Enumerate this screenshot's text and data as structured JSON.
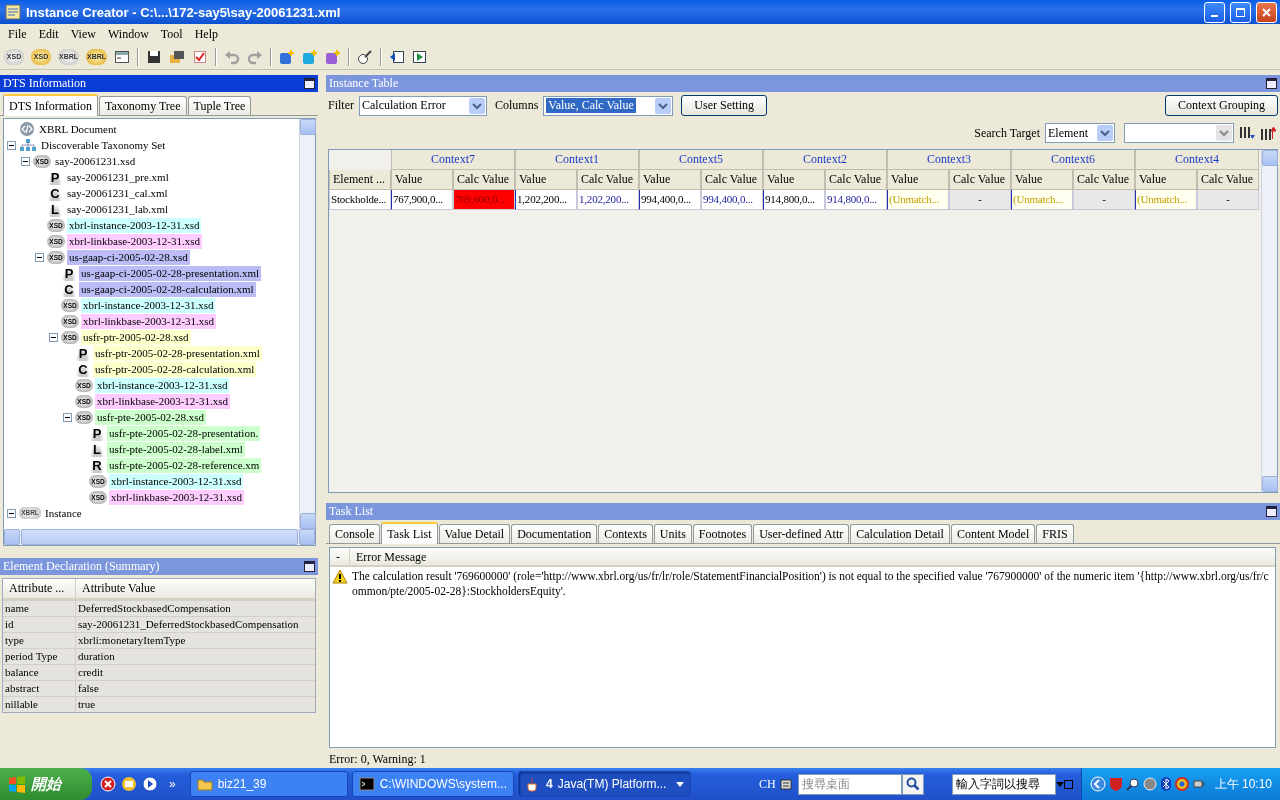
{
  "window": {
    "title": "Instance Creator - C:\\...\\172-say5\\say-20061231.xml"
  },
  "menu": [
    "File",
    "Edit",
    "View",
    "Window",
    "Tool",
    "Help"
  ],
  "toolbar": [
    {
      "kind": "xsd",
      "badge": "XSD"
    },
    {
      "kind": "xsd-open",
      "badge": "XSD"
    },
    {
      "kind": "xbrl",
      "badge": "XBRL"
    },
    {
      "kind": "xbrl-open",
      "badge": "XBRL"
    },
    {
      "kind": "window"
    },
    {
      "kind": "separator"
    },
    {
      "kind": "save"
    },
    {
      "kind": "folders"
    },
    {
      "kind": "check"
    },
    {
      "kind": "separator"
    },
    {
      "kind": "undo",
      "disabled": true
    },
    {
      "kind": "redo",
      "disabled": true
    },
    {
      "kind": "separator"
    },
    {
      "kind": "add-blue"
    },
    {
      "kind": "add-cyan"
    },
    {
      "kind": "add-purple"
    },
    {
      "kind": "separator"
    },
    {
      "kind": "tool"
    },
    {
      "kind": "separator"
    },
    {
      "kind": "prev"
    },
    {
      "kind": "next"
    }
  ],
  "dts_panel": {
    "title": "DTS Information",
    "active": true,
    "tabs": [
      {
        "label": "DTS Information",
        "selected": true
      },
      {
        "label": "Taxonomy Tree",
        "selected": false
      },
      {
        "label": "Tuple Tree",
        "selected": false
      }
    ],
    "tree": [
      {
        "kind": "document",
        "label": "XBRL Document"
      },
      {
        "kind": "dts",
        "label": "Discoverable Taxonomy Set",
        "expanded": true,
        "children": [
          {
            "kind": "schema",
            "badge": "XSD",
            "label": "say-20061231.xsd",
            "expanded": true,
            "children": [
              {
                "kind": "linkbase",
                "badge": "P",
                "label": "say-20061231_pre.xml"
              },
              {
                "kind": "linkbase",
                "badge": "C",
                "label": "say-20061231_cal.xml"
              },
              {
                "kind": "linkbase",
                "badge": "L",
                "label": "say-20061231_lab.xml"
              },
              {
                "kind": "schema",
                "badge": "XSD",
                "label": "xbrl-instance-2003-12-31.xsd",
                "color": "#ccffff"
              },
              {
                "kind": "schema",
                "badge": "XSD",
                "label": "xbrl-linkbase-2003-12-31.xsd",
                "color": "#ffccff"
              },
              {
                "kind": "schema",
                "badge": "XSD",
                "label": "us-gaap-ci-2005-02-28.xsd",
                "color": "#bbbbf5",
                "expanded": true,
                "children": [
                  {
                    "kind": "linkbase",
                    "badge": "P",
                    "label": "us-gaap-ci-2005-02-28-presentation.xml",
                    "color": "#bbbbf5"
                  },
                  {
                    "kind": "linkbase",
                    "badge": "C",
                    "label": "us-gaap-ci-2005-02-28-calculation.xml",
                    "color": "#bbbbf5"
                  },
                  {
                    "kind": "schema",
                    "badge": "XSD",
                    "label": "xbrl-instance-2003-12-31.xsd",
                    "color": "#ccffff"
                  },
                  {
                    "kind": "schema",
                    "badge": "XSD",
                    "label": "xbrl-linkbase-2003-12-31.xsd",
                    "color": "#ffccff"
                  },
                  {
                    "kind": "schema",
                    "badge": "XSD",
                    "label": "usfr-ptr-2005-02-28.xsd",
                    "color": "#ffffcc",
                    "expanded": true,
                    "children": [
                      {
                        "kind": "linkbase",
                        "badge": "P",
                        "label": "usfr-ptr-2005-02-28-presentation.xml",
                        "color": "#ffffcc"
                      },
                      {
                        "kind": "linkbase",
                        "badge": "C",
                        "label": "usfr-ptr-2005-02-28-calculation.xml",
                        "color": "#ffffcc"
                      },
                      {
                        "kind": "schema",
                        "badge": "XSD",
                        "label": "xbrl-instance-2003-12-31.xsd",
                        "color": "#ccffff"
                      },
                      {
                        "kind": "schema",
                        "badge": "XSD",
                        "label": "xbrl-linkbase-2003-12-31.xsd",
                        "color": "#ffccff"
                      },
                      {
                        "kind": "schema",
                        "badge": "XSD",
                        "label": "usfr-pte-2005-02-28.xsd",
                        "color": "#ccffcc",
                        "expanded": true,
                        "children": [
                          {
                            "kind": "linkbase",
                            "badge": "P",
                            "label": "usfr-pte-2005-02-28-presentation.",
                            "color": "#ccffcc"
                          },
                          {
                            "kind": "linkbase",
                            "badge": "L",
                            "label": "usfr-pte-2005-02-28-label.xml",
                            "color": "#ccffcc"
                          },
                          {
                            "kind": "linkbase",
                            "badge": "R",
                            "label": "usfr-pte-2005-02-28-reference.xm",
                            "color": "#ccffcc"
                          },
                          {
                            "kind": "schema",
                            "badge": "XSD",
                            "label": "xbrl-instance-2003-12-31.xsd",
                            "color": "#ccffff"
                          },
                          {
                            "kind": "schema",
                            "badge": "XSD",
                            "label": "xbrl-linkbase-2003-12-31.xsd",
                            "color": "#ffccff"
                          }
                        ]
                      }
                    ]
                  }
                ]
              }
            ]
          }
        ]
      },
      {
        "kind": "instance",
        "badge": "XBRL",
        "label": "Instance",
        "expanded": true
      }
    ]
  },
  "element_declaration": {
    "title": "Element Declaration (Summary)",
    "active": false,
    "columns": [
      "Attribute ...",
      "Attribute Value"
    ],
    "rows": [
      [
        "name",
        "DeferredStockbasedCompensation"
      ],
      [
        "id",
        "say-20061231_DeferredStockbasedCompensation"
      ],
      [
        "type",
        "xbrli:monetaryItemType"
      ],
      [
        "period Type",
        "duration"
      ],
      [
        "balance",
        "credit"
      ],
      [
        "abstract",
        "false"
      ],
      [
        "nillable",
        "true"
      ]
    ]
  },
  "instance_table": {
    "title": "Instance Table",
    "active": false,
    "filter_label": "Filter",
    "filter": "Calculation Error",
    "columns_label": "Columns",
    "columns_value": "Value, Calc Value",
    "user_setting": "User Setting",
    "context_grouping": "Context Grouping",
    "search_label": "Search Target",
    "search_target": "Element",
    "corner": "Element ...",
    "contexts": [
      {
        "name": "Context7",
        "value_header": "Value",
        "calc_header": "Calc Value"
      },
      {
        "name": "Context1",
        "value_header": "Value",
        "calc_header": "Calc Value"
      },
      {
        "name": "Context5",
        "value_header": "Value",
        "calc_header": "Calc Value"
      },
      {
        "name": "Context2",
        "value_header": "Value",
        "calc_header": "Calc Value"
      },
      {
        "name": "Context3",
        "value_header": "Value",
        "calc_header": "Calc Value"
      },
      {
        "name": "Context6",
        "value_header": "Value",
        "calc_header": "Calc Value"
      },
      {
        "name": "Context4",
        "value_header": "Value",
        "calc_header": "Calc Value"
      }
    ],
    "rows": [
      {
        "element": "Stockholde...",
        "cells": [
          {
            "value": "767,900,0...",
            "unmatched": false,
            "calc": "769,600,0...",
            "calc_error": true,
            "calc_matched": false
          },
          {
            "value": "1,202,200...",
            "unmatched": false,
            "calc": "1,202,200...",
            "calc_error": false,
            "calc_matched": true
          },
          {
            "value": "994,400,0...",
            "unmatched": false,
            "calc": "994,400,0...",
            "calc_error": false,
            "calc_matched": true
          },
          {
            "value": "914,800,0...",
            "unmatched": false,
            "calc": "914,800,0...",
            "calc_error": false,
            "calc_matched": true
          },
          {
            "value": "(Unmatch...",
            "unmatched": true,
            "calc": "-",
            "calc_error": false,
            "calc_matched": false
          },
          {
            "value": "(Unmatch...",
            "unmatched": true,
            "calc": "-",
            "calc_error": false,
            "calc_matched": false
          },
          {
            "value": "(Unmatch...",
            "unmatched": true,
            "calc": "-",
            "calc_error": false,
            "calc_matched": false
          }
        ]
      }
    ]
  },
  "task_list": {
    "title": "Task List",
    "active": false,
    "tabs": [
      {
        "label": "Console",
        "selected": false
      },
      {
        "label": "Task List",
        "selected": true
      },
      {
        "label": "Value Detail",
        "selected": false
      },
      {
        "label": "Documentation",
        "selected": false
      },
      {
        "label": "Contexts",
        "selected": false
      },
      {
        "label": "Units",
        "selected": false
      },
      {
        "label": "Footnotes",
        "selected": false
      },
      {
        "label": "User-defined Attr",
        "selected": false
      },
      {
        "label": "Calculation Detail",
        "selected": false
      },
      {
        "label": "Content Model",
        "selected": false
      },
      {
        "label": "FRIS",
        "selected": false
      }
    ],
    "columns": [
      "-",
      "Error Message"
    ],
    "rows": [
      {
        "kind": "warning",
        "message": "The calculation result '769600000' (role='http://www.xbrl.org/us/fr/lr/role/StatementFinancialPosition') is not equal to the specified value '767900000' of the numeric item '{http://www.xbrl.org/us/fr/common/pte/2005-02-28}:StockholdersEquity'."
      }
    ],
    "status": "Error: 0, Warning: 1"
  },
  "taskbar": {
    "start": "開始",
    "more": "»",
    "tasks": [
      {
        "kind": "folder",
        "label": "biz21_39",
        "selected": false
      },
      {
        "kind": "console",
        "label": "C:\\WINDOWS\\system...",
        "selected": false
      },
      {
        "kind": "java",
        "count": "4",
        "label": "Java(TM) Platform...",
        "selected": true
      }
    ],
    "language": "CH",
    "search_placeholder": "搜尋桌面",
    "search2_placeholder": "輸入字詞以搜尋",
    "clock": "上午 10:10"
  }
}
